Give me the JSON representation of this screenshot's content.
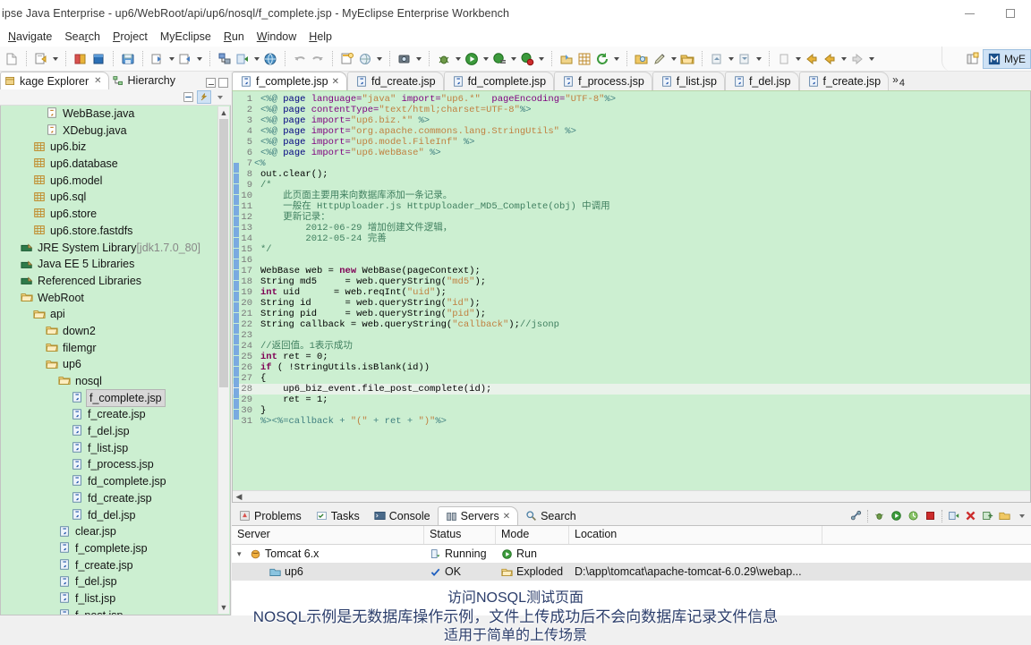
{
  "window": {
    "title": "ipse Java Enterprise - up6/WebRoot/api/up6/nosql/f_complete.jsp - MyEclipse Enterprise Workbench",
    "minimize_label": "Minimize",
    "maximize_label": "Maximize"
  },
  "menubar": {
    "items": [
      {
        "label": "Navigate",
        "mnemonic": "N"
      },
      {
        "label": "Search",
        "mnemonic": "r"
      },
      {
        "label": "Project",
        "mnemonic": "P"
      },
      {
        "label": "MyEclipse",
        "mnemonic": ""
      },
      {
        "label": "Run",
        "mnemonic": "R"
      },
      {
        "label": "Window",
        "mnemonic": "W"
      },
      {
        "label": "Help",
        "mnemonic": "H"
      }
    ]
  },
  "toolbar": {
    "perspective_label": "MyE",
    "open_perspective_tooltip": "Open Perspective",
    "icons": [
      "new-file-icon",
      "new-wizard-icon",
      "new-project-icon",
      "import-icon",
      "export-icon",
      "save-icon",
      "print-icon",
      "build-icon",
      "deploy-icon",
      "globe-icon",
      "undo-icon",
      "redo-icon",
      "new-jsp-icon",
      "web-browser-icon",
      "snapshot-icon",
      "debug-icon",
      "run-icon",
      "profile-icon",
      "coverage-icon",
      "open-type-icon",
      "new-class-icon",
      "refresh-icon",
      "search-folder-icon",
      "edit-icon",
      "open-icon",
      "prev-annotation-icon",
      "next-annotation-icon",
      "back-icon",
      "forward-icon"
    ]
  },
  "explorer": {
    "tabs": [
      {
        "label": "kage Explorer",
        "selected": true,
        "icon": "package-explorer-icon",
        "closeable": true
      },
      {
        "label": "Hierarchy",
        "selected": false,
        "icon": "hierarchy-icon",
        "closeable": false
      }
    ],
    "view_tools": [
      "collapse-all-icon",
      "link-with-editor-icon",
      "view-menu-icon"
    ],
    "tree": [
      {
        "label": "WebBase.java",
        "indent": 3,
        "icon": "java-file-icon",
        "dim": ""
      },
      {
        "label": "XDebug.java",
        "indent": 3,
        "icon": "java-file-icon",
        "dim": ""
      },
      {
        "label": "up6.biz",
        "indent": 2,
        "icon": "package-icon",
        "dim": ""
      },
      {
        "label": "up6.database",
        "indent": 2,
        "icon": "package-icon",
        "dim": ""
      },
      {
        "label": "up6.model",
        "indent": 2,
        "icon": "package-icon",
        "dim": ""
      },
      {
        "label": "up6.sql",
        "indent": 2,
        "icon": "package-icon",
        "dim": ""
      },
      {
        "label": "up6.store",
        "indent": 2,
        "icon": "package-icon",
        "dim": ""
      },
      {
        "label": "up6.store.fastdfs",
        "indent": 2,
        "icon": "package-icon",
        "dim": ""
      },
      {
        "label": "JRE System Library",
        "indent": 1,
        "icon": "library-icon",
        "dim": "[jdk1.7.0_80]"
      },
      {
        "label": "Java EE 5 Libraries",
        "indent": 1,
        "icon": "library-icon",
        "dim": ""
      },
      {
        "label": "Referenced Libraries",
        "indent": 1,
        "icon": "library-icon",
        "dim": ""
      },
      {
        "label": "WebRoot",
        "indent": 1,
        "icon": "folder-icon",
        "dim": ""
      },
      {
        "label": "api",
        "indent": 2,
        "icon": "folder-icon",
        "dim": ""
      },
      {
        "label": "down2",
        "indent": 3,
        "icon": "folder-icon",
        "dim": ""
      },
      {
        "label": "filemgr",
        "indent": 3,
        "icon": "folder-icon",
        "dim": ""
      },
      {
        "label": "up6",
        "indent": 3,
        "icon": "folder-icon",
        "dim": ""
      },
      {
        "label": "nosql",
        "indent": 4,
        "icon": "folder-icon",
        "dim": ""
      },
      {
        "label": "f_complete.jsp",
        "indent": 5,
        "icon": "jsp-file-icon",
        "dim": "",
        "selected": true
      },
      {
        "label": "f_create.jsp",
        "indent": 5,
        "icon": "jsp-file-icon",
        "dim": ""
      },
      {
        "label": "f_del.jsp",
        "indent": 5,
        "icon": "jsp-file-icon",
        "dim": ""
      },
      {
        "label": "f_list.jsp",
        "indent": 5,
        "icon": "jsp-file-icon",
        "dim": ""
      },
      {
        "label": "f_process.jsp",
        "indent": 5,
        "icon": "jsp-file-icon",
        "dim": ""
      },
      {
        "label": "fd_complete.jsp",
        "indent": 5,
        "icon": "jsp-file-icon",
        "dim": ""
      },
      {
        "label": "fd_create.jsp",
        "indent": 5,
        "icon": "jsp-file-icon",
        "dim": ""
      },
      {
        "label": "fd_del.jsp",
        "indent": 5,
        "icon": "jsp-file-icon",
        "dim": ""
      },
      {
        "label": "clear.jsp",
        "indent": 4,
        "icon": "jsp-file-icon",
        "dim": ""
      },
      {
        "label": "f_complete.jsp",
        "indent": 4,
        "icon": "jsp-file-icon",
        "dim": ""
      },
      {
        "label": "f_create.jsp",
        "indent": 4,
        "icon": "jsp-file-icon",
        "dim": ""
      },
      {
        "label": "f_del.jsp",
        "indent": 4,
        "icon": "jsp-file-icon",
        "dim": ""
      },
      {
        "label": "f_list.jsp",
        "indent": 4,
        "icon": "jsp-file-icon",
        "dim": ""
      },
      {
        "label": "f_post.jsp",
        "indent": 4,
        "icon": "jsp-file-icon",
        "dim": ""
      }
    ]
  },
  "editor": {
    "tabs": [
      {
        "label": "f_complete.jsp",
        "active": true,
        "closeable": true
      },
      {
        "label": "fd_create.jsp",
        "active": false,
        "closeable": false
      },
      {
        "label": "fd_complete.jsp",
        "active": false,
        "closeable": false
      },
      {
        "label": "f_process.jsp",
        "active": false,
        "closeable": false
      },
      {
        "label": "f_list.jsp",
        "active": false,
        "closeable": false
      },
      {
        "label": "f_del.jsp",
        "active": false,
        "closeable": false
      },
      {
        "label": "f_create.jsp",
        "active": false,
        "closeable": false
      }
    ],
    "overflow_count": "4",
    "overflow_symbol": "»",
    "lines": [
      {
        "n": "1",
        "segs": [
          {
            "t": "<%@ ",
            "c": "jsp"
          },
          {
            "t": "page ",
            "c": "tag"
          },
          {
            "t": "language=",
            "c": "attr"
          },
          {
            "t": "\"java\"",
            "c": "str"
          },
          {
            "t": " import=",
            "c": "attr"
          },
          {
            "t": "\"up6.*\"",
            "c": "str"
          },
          {
            "t": "  pageEncoding=",
            "c": "attr"
          },
          {
            "t": "\"UTF-8\"",
            "c": "str"
          },
          {
            "t": "%>",
            "c": "jsp"
          }
        ]
      },
      {
        "n": "2",
        "segs": [
          {
            "t": "<%@ ",
            "c": "jsp"
          },
          {
            "t": "page ",
            "c": "tag"
          },
          {
            "t": "contentType=",
            "c": "attr"
          },
          {
            "t": "\"text/html;charset=UTF-8\"",
            "c": "str"
          },
          {
            "t": "%>",
            "c": "jsp"
          }
        ]
      },
      {
        "n": "3",
        "segs": [
          {
            "t": "<%@ ",
            "c": "jsp"
          },
          {
            "t": "page ",
            "c": "tag"
          },
          {
            "t": "import=",
            "c": "attr"
          },
          {
            "t": "\"up6.biz.*\"",
            "c": "str"
          },
          {
            "t": " %>",
            "c": "jsp"
          }
        ]
      },
      {
        "n": "4",
        "segs": [
          {
            "t": "<%@ ",
            "c": "jsp"
          },
          {
            "t": "page ",
            "c": "tag"
          },
          {
            "t": "import=",
            "c": "attr"
          },
          {
            "t": "\"org.apache.commons.lang.StringUtils\"",
            "c": "str"
          },
          {
            "t": " %>",
            "c": "jsp"
          }
        ]
      },
      {
        "n": "5",
        "segs": [
          {
            "t": "<%@ ",
            "c": "jsp"
          },
          {
            "t": "page ",
            "c": "tag"
          },
          {
            "t": "import=",
            "c": "attr"
          },
          {
            "t": "\"up6.model.FileInf\"",
            "c": "str"
          },
          {
            "t": " %>",
            "c": "jsp"
          }
        ]
      },
      {
        "n": "6",
        "segs": [
          {
            "t": "<%@ ",
            "c": "jsp"
          },
          {
            "t": "page ",
            "c": "tag"
          },
          {
            "t": "import=",
            "c": "attr"
          },
          {
            "t": "\"up6.WebBase\"",
            "c": "str"
          },
          {
            "t": " %>",
            "c": "jsp"
          }
        ]
      },
      {
        "n": "7",
        "segs": [
          {
            "t": "<%",
            "c": "jsp"
          }
        ],
        "fold": true
      },
      {
        "n": "8",
        "segs": [
          {
            "t": "out.clear();",
            "c": ""
          }
        ]
      },
      {
        "n": "9",
        "segs": [
          {
            "t": "/*",
            "c": "cmt"
          }
        ]
      },
      {
        "n": "10",
        "segs": [
          {
            "t": "    此页面主要用来向数据库添加一条记录。",
            "c": "cmt"
          }
        ]
      },
      {
        "n": "11",
        "segs": [
          {
            "t": "    一般在 HttpUploader.js HttpUploader_MD5_Complete(obj) 中调用",
            "c": "cmt"
          }
        ]
      },
      {
        "n": "12",
        "segs": [
          {
            "t": "    更新记录：",
            "c": "cmt"
          }
        ]
      },
      {
        "n": "13",
        "segs": [
          {
            "t": "        2012-06-29 增加创建文件逻辑，",
            "c": "cmt"
          }
        ]
      },
      {
        "n": "14",
        "segs": [
          {
            "t": "        2012-05-24 完善",
            "c": "cmt"
          }
        ]
      },
      {
        "n": "15",
        "segs": [
          {
            "t": "*/",
            "c": "cmt"
          }
        ]
      },
      {
        "n": "16",
        "segs": [
          {
            "t": "",
            "c": ""
          }
        ]
      },
      {
        "n": "17",
        "segs": [
          {
            "t": "WebBase web = ",
            "c": ""
          },
          {
            "t": "new ",
            "c": "kw"
          },
          {
            "t": "WebBase(pageContext);",
            "c": ""
          }
        ]
      },
      {
        "n": "18",
        "segs": [
          {
            "t": "String md5     = web.queryString(",
            "c": ""
          },
          {
            "t": "\"md5\"",
            "c": "str"
          },
          {
            "t": ");",
            "c": ""
          }
        ]
      },
      {
        "n": "19",
        "segs": [
          {
            "t": "int ",
            "c": "kw"
          },
          {
            "t": "uid      = web.reqInt(",
            "c": ""
          },
          {
            "t": "\"uid\"",
            "c": "str"
          },
          {
            "t": ");",
            "c": ""
          }
        ]
      },
      {
        "n": "20",
        "segs": [
          {
            "t": "String id      = web.queryString(",
            "c": ""
          },
          {
            "t": "\"id\"",
            "c": "str"
          },
          {
            "t": ");",
            "c": ""
          }
        ]
      },
      {
        "n": "21",
        "segs": [
          {
            "t": "String pid     = web.queryString(",
            "c": ""
          },
          {
            "t": "\"pid\"",
            "c": "str"
          },
          {
            "t": ");",
            "c": ""
          }
        ]
      },
      {
        "n": "22",
        "segs": [
          {
            "t": "String callback = web.queryString(",
            "c": ""
          },
          {
            "t": "\"callback\"",
            "c": "str"
          },
          {
            "t": ");",
            "c": ""
          },
          {
            "t": "//jsonp",
            "c": "cmt"
          }
        ]
      },
      {
        "n": "23",
        "segs": [
          {
            "t": "",
            "c": ""
          }
        ]
      },
      {
        "n": "24",
        "segs": [
          {
            "t": "//返回值。1表示成功",
            "c": "cmt"
          }
        ]
      },
      {
        "n": "25",
        "segs": [
          {
            "t": "int ",
            "c": "kw"
          },
          {
            "t": "ret = 0;",
            "c": ""
          }
        ]
      },
      {
        "n": "26",
        "segs": [
          {
            "t": "if ",
            "c": "kw"
          },
          {
            "t": "( !StringUtils.isBlank(id))",
            "c": ""
          }
        ]
      },
      {
        "n": "27",
        "segs": [
          {
            "t": "{",
            "c": ""
          }
        ]
      },
      {
        "n": "28",
        "segs": [
          {
            "t": "    up6_biz_event.file_post_complete(id);",
            "c": ""
          }
        ],
        "highlight": true
      },
      {
        "n": "29",
        "segs": [
          {
            "t": "    ret = 1;",
            "c": ""
          }
        ]
      },
      {
        "n": "30",
        "segs": [
          {
            "t": "}",
            "c": ""
          }
        ]
      },
      {
        "n": "31",
        "segs": [
          {
            "t": "%><%=callback + ",
            "c": "jsp"
          },
          {
            "t": "\"(\"",
            "c": "str"
          },
          {
            "t": " + ret + ",
            "c": "jsp"
          },
          {
            "t": "\")\"",
            "c": "str"
          },
          {
            "t": "%>",
            "c": "jsp"
          }
        ]
      }
    ]
  },
  "bottom_panel": {
    "tabs": [
      {
        "label": "Problems",
        "active": false,
        "icon": "problems-icon",
        "closeable": false
      },
      {
        "label": "Tasks",
        "active": false,
        "icon": "tasks-icon",
        "closeable": false
      },
      {
        "label": "Console",
        "active": false,
        "icon": "console-icon",
        "closeable": false
      },
      {
        "label": "Servers",
        "active": true,
        "icon": "servers-icon",
        "closeable": true
      },
      {
        "label": "Search",
        "active": false,
        "icon": "search-icon",
        "closeable": false
      }
    ],
    "tools": [
      "link-icon",
      "debug-server-icon",
      "start-server-icon",
      "profile-server-icon",
      "stop-server-icon",
      "publish-icon",
      "remove-server-icon",
      "add-deployment-icon",
      "open-folder-icon",
      "view-menu-icon"
    ],
    "columns": [
      "Server",
      "Status",
      "Mode",
      "Location"
    ],
    "rows": [
      {
        "server": "Tomcat  6.x",
        "status": "Running",
        "mode": "Run",
        "location": "",
        "indent": 0,
        "expanded": true,
        "selected": false,
        "server_icon": "tomcat-icon",
        "status_icon": "running-icon",
        "mode_icon": "run-icon"
      },
      {
        "server": "up6",
        "status": "OK",
        "mode": "Exploded",
        "location": "D:\\app\\tomcat\\apache-tomcat-6.0.29\\webap...",
        "indent": 1,
        "expanded": false,
        "selected": true,
        "server_icon": "module-icon",
        "status_icon": "ok-check-icon",
        "mode_icon": "exploded-folder-icon"
      }
    ]
  },
  "captions": {
    "line1": "访问NOSQL测试页面",
    "line2": "NOSQL示例是无数据库操作示例，文件上传成功后不会向数据库记录文件信息",
    "line3": "适用于简单的上传场景"
  },
  "colors": {
    "editor_background": "#ccefd1",
    "tree_background": "#ccefd1",
    "selection": "#d8d8d8",
    "accent": "#cfe2f5",
    "caption_text": "#2c3e6b"
  }
}
